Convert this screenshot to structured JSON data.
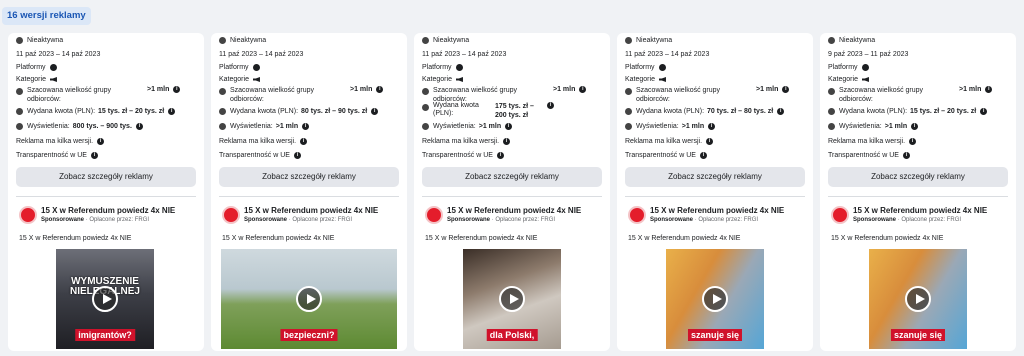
{
  "header": {
    "badge": "16 wersji reklamy"
  },
  "labels": {
    "status": "Nieaktywna",
    "platforms": "Platformy",
    "categories": "Kategorie",
    "audience": "Szacowana wielkość grupy odbiorców:",
    "audience_value": ">1 mln",
    "spend": "Wydana kwota (PLN):",
    "views": "Wyświetlenia:",
    "multi": "Reklama ma kilka wersji.",
    "transparency": "Transparentność w UE",
    "details_button": "Zobacz szczegóły reklamy",
    "sponsored": "Sponsorowane",
    "paid_by": "· Opłacone przez:",
    "payer": "FRGI"
  },
  "cards": [
    {
      "dates": "11 paź 2023 – 14 paź 2023",
      "spend": "15 tys. zł – 20 tys. zł",
      "views": "800 tys. – 900 tys.",
      "page_name": "15 X w Referendum powiedz 4x NIE",
      "ad_text": "15 X w Referendum powiedz 4x NIE",
      "caption": "imigrantów?",
      "headline": "WYMUSZENIE NIELEGALNEJ"
    },
    {
      "dates": "11 paź 2023 – 14 paź 2023",
      "spend": "80 tys. zł – 90 tys. zł",
      "views": ">1 mln",
      "page_name": "15 X w Referendum powiedz 4x NIE",
      "ad_text": "15 X w Referendum powiedz 4x NIE",
      "caption": "bezpieczni?",
      "headline": ""
    },
    {
      "dates": "11 paź 2023 – 14 paź 2023",
      "spend": "175 tys. zł – 200 tys. zł",
      "views": ">1 mln",
      "page_name": "15 X w Referendum powiedz 4x NIE",
      "ad_text": "15 X w Referendum powiedz 4x NIE",
      "caption": "dla Polski,",
      "headline": ""
    },
    {
      "dates": "11 paź 2023 – 14 paź 2023",
      "spend": "70 tys. zł – 80 tys. zł",
      "views": ">1 mln",
      "page_name": "15 X w Referendum powiedz 4x NIE",
      "ad_text": "15 X w Referendum powiedz 4x NIE",
      "caption": "szanuje się",
      "headline": ""
    },
    {
      "dates": "9 paź 2023 – 11 paź 2023",
      "spend": "15 tys. zł – 20 tys. zł",
      "views": ">1 mln",
      "page_name": "15 X w Referendum powiedz 4x NIE",
      "ad_text": "15 X w Referendum powiedz 4x NIE",
      "caption": "szanuje się",
      "headline": ""
    }
  ]
}
